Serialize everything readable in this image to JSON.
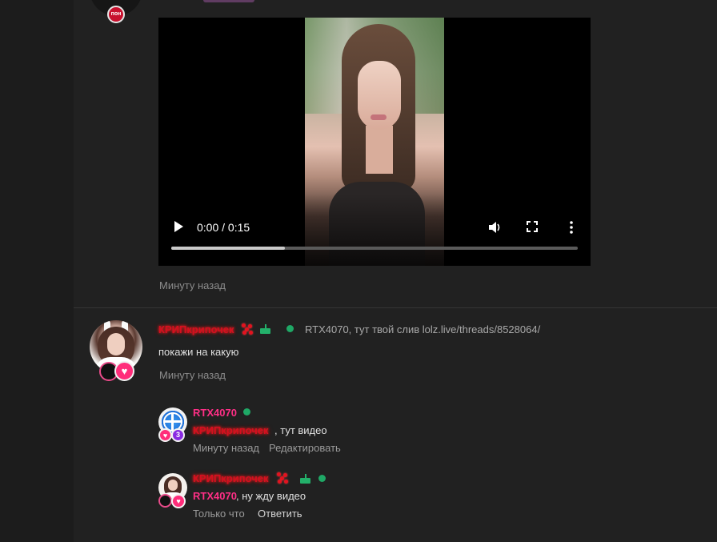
{
  "top_post": {
    "badge_text": "пон",
    "timestamp": "Минуту назад"
  },
  "video": {
    "time": "0:00 / 0:15",
    "progress_fraction": 0.28
  },
  "comment": {
    "author": "КРИПкрипочек",
    "reply_to": "RTX4070, тут твой слив lolz.live/threads/8528064/",
    "text": "покажи на какую",
    "timestamp": "Минуту назад"
  },
  "replies": [
    {
      "author": "RTX4070",
      "mention": "КРИПкрипочек",
      "text": ", тут видео",
      "timestamp": "Минуту назад",
      "action": "Редактировать",
      "badge_count": "3"
    },
    {
      "author": "КРИПкрипочек",
      "mention": "RTX4070",
      "text": ", ну жду видео",
      "timestamp": "Только что",
      "action": "Ответить"
    }
  ],
  "colors": {
    "online": "#1fa866",
    "name_pink": "#ff2f86",
    "name_red": "#d50f1f"
  }
}
